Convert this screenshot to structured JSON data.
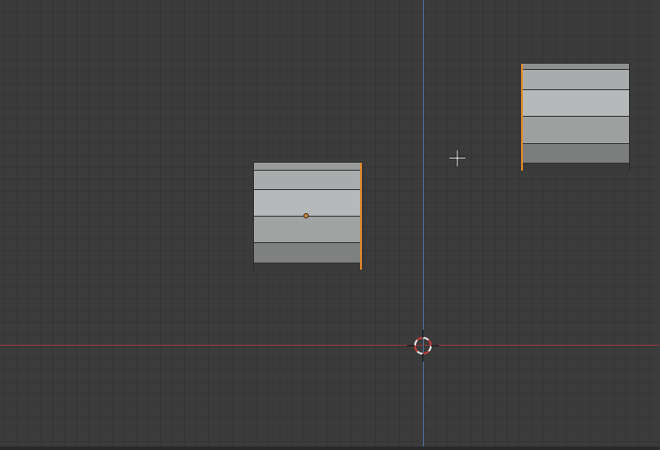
{
  "viewport": {
    "background_color": "#3b3b3b",
    "grid_line_color": "#333333",
    "x_axis_color": "#9a3b41",
    "y_axis_color": "#4f6f9a",
    "selection_color": "#e4892a"
  },
  "objects": [
    {
      "name": "left-object",
      "selected_edge": "right",
      "has_origin_point": true,
      "band_colors": [
        "#9a9c9c",
        "#a9acac",
        "#b5b9b9",
        "#a1a3a3",
        "#7f8080",
        "#3a3a3a"
      ]
    },
    {
      "name": "right-object",
      "selected_edge": "left",
      "has_origin_point": false,
      "band_colors": [
        "#8f9191",
        "#a9acac",
        "#b5b9b9",
        "#9e9f9f",
        "#7c7d7d",
        "#3a3a3a"
      ]
    }
  ],
  "icons": {
    "cursor_3d": "3d-cursor-icon",
    "mouse_cursor": "crosshair-cursor-icon"
  }
}
